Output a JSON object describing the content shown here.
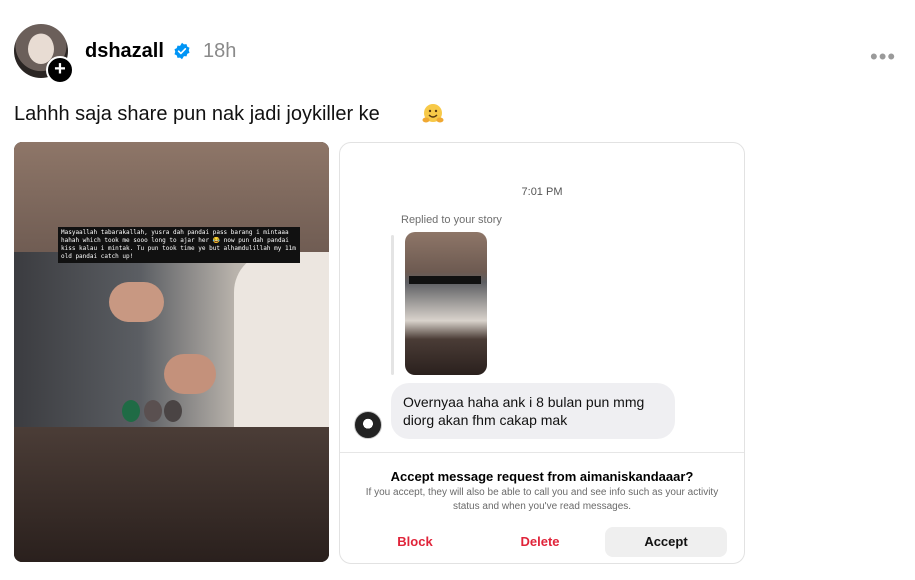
{
  "post": {
    "username": "dshazall",
    "time": "18h",
    "more": "•••",
    "caption": "Lahhh saja share pun nak jadi joykiller ke",
    "emoji_icon": "hugging-face-emoji",
    "overlay_text": "Masyaallah tabarakallah, yusra dah pandai pass barang i mintaaa hahah which took me sooo long to ajar her 😂 now pun dah pandai kiss kalau i mintak. Tu pun took time ye but alhamdulillah my 11m old pandai catch up!"
  },
  "dm": {
    "time": "7:01 PM",
    "replied_label": "Replied to your story",
    "message": "Overnyaa haha ank i 8 bulan pun mmg diorg akan fhm cakap mak",
    "request_title": "Accept message request from aimaniskandaaar?",
    "request_desc": "If you accept, they will also be able to call you and see info such as your activity status and when you've read messages.",
    "buttons": {
      "block": "Block",
      "delete": "Delete",
      "accept": "Accept"
    }
  },
  "colors": {
    "danger": "#e0243a",
    "verified": "#0095f6",
    "muted": "#8a8a8a"
  }
}
